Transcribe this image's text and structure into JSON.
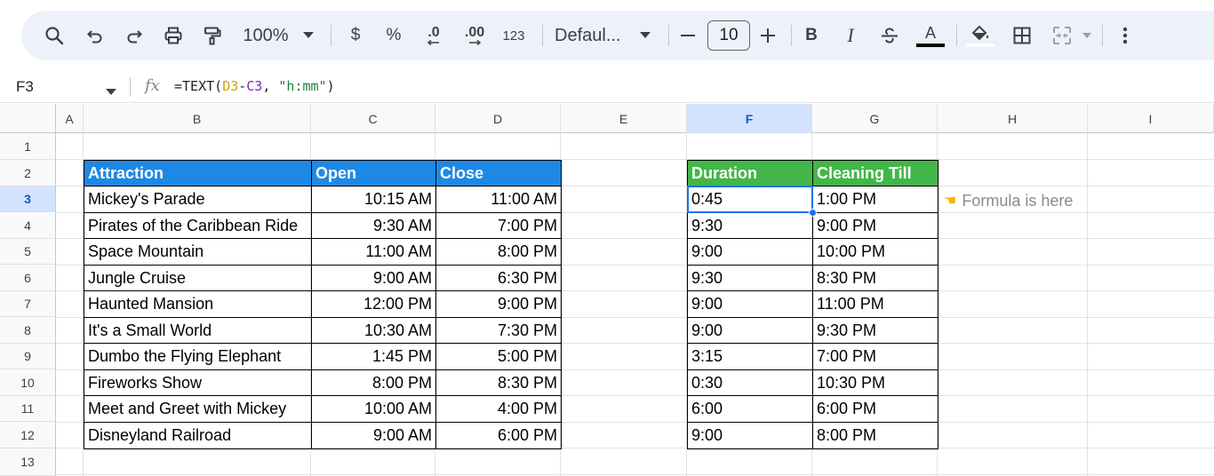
{
  "toolbar": {
    "zoom": "100%",
    "currency": "$",
    "percent": "%",
    "decrease_decimal": ".0",
    "increase_decimal": ".00",
    "more_formats": "123",
    "font_name": "Defaul...",
    "font_size": "10",
    "bold": "B",
    "italic": "I",
    "text_color": "A"
  },
  "formula_bar": {
    "cell_ref": "F3",
    "formula_prefix": "=TEXT(",
    "ref1": "D3",
    "minus": "-",
    "ref2": "C3",
    "comma": ", ",
    "format_str": "\"h:mm\"",
    "close": ")"
  },
  "columns": [
    "A",
    "B",
    "C",
    "D",
    "E",
    "F",
    "G",
    "H",
    "I"
  ],
  "rows": [
    "1",
    "2",
    "3",
    "4",
    "5",
    "6",
    "7",
    "8",
    "9",
    "10",
    "11",
    "12",
    "13"
  ],
  "table1": {
    "headers": [
      "Attraction",
      "Open",
      "Close"
    ],
    "rows": [
      [
        "Mickey's Parade",
        "10:15 AM",
        "11:00 AM"
      ],
      [
        "Pirates of the Caribbean Ride",
        "9:30 AM",
        "7:00 PM"
      ],
      [
        "Space Mountain",
        "11:00 AM",
        "8:00 PM"
      ],
      [
        "Jungle Cruise",
        "9:00 AM",
        "6:30 PM"
      ],
      [
        "Haunted Mansion",
        "12:00 PM",
        "9:00 PM"
      ],
      [
        "It's a Small World",
        "10:30 AM",
        "7:30 PM"
      ],
      [
        "Dumbo the Flying Elephant",
        "1:45 PM",
        "5:00 PM"
      ],
      [
        "Fireworks Show",
        "8:00 PM",
        "8:30 PM"
      ],
      [
        "Meet and Greet with Mickey",
        "10:00 AM",
        "4:00 PM"
      ],
      [
        "Disneyland Railroad",
        "9:00 AM",
        "6:00 PM"
      ]
    ]
  },
  "table2": {
    "headers": [
      "Duration",
      "Cleaning Till"
    ],
    "rows": [
      [
        "0:45",
        "1:00 PM"
      ],
      [
        "9:30",
        "9:00 PM"
      ],
      [
        "9:00",
        "10:00 PM"
      ],
      [
        "9:30",
        "8:30 PM"
      ],
      [
        "9:00",
        "11:00 PM"
      ],
      [
        "9:00",
        "9:30 PM"
      ],
      [
        "3:15",
        "7:00 PM"
      ],
      [
        "0:30",
        "10:30 PM"
      ],
      [
        "6:00",
        "6:00 PM"
      ],
      [
        "9:00",
        "8:00 PM"
      ]
    ]
  },
  "note": "Formula is here",
  "colors": {
    "header_blue": "#1e88e5",
    "header_green": "#43b649",
    "selection": "#1a73e8"
  }
}
